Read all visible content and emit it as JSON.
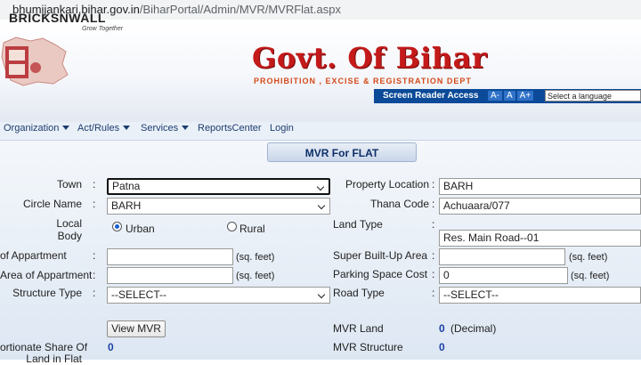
{
  "browser": {
    "url_host": "bhumijankari.bihar.gov.in",
    "url_path": "/BiharPortal/Admin/MVR/MVRFlat.aspx"
  },
  "header": {
    "brand_logo": "BRICKSNWALL",
    "brand_tagline": "Grow Together",
    "title": "Govt. Of Bihar",
    "subtitle": "PROHIBITION , EXCISE & REGISTRATION DEPT",
    "screen_reader_label": "Screen Reader Access",
    "font_buttons": [
      "A-",
      "A",
      "A+"
    ],
    "language_select": "Select a language"
  },
  "nav": {
    "items": [
      {
        "label": "Organization",
        "dropdown": true
      },
      {
        "label": "Act/Rules",
        "dropdown": true
      },
      {
        "label": "Services",
        "dropdown": true
      },
      {
        "label": "ReportsCenter",
        "dropdown": false
      },
      {
        "label": "Login",
        "dropdown": false
      }
    ]
  },
  "form": {
    "title": "MVR For FLAT",
    "town": {
      "label": "Town",
      "value": "Patna"
    },
    "circle_name": {
      "label": "Circle Name",
      "value": "BARH"
    },
    "local_body": {
      "label_line1": "Local",
      "label_line2": "Body",
      "option_urban": "Urban",
      "option_rural": "Rural",
      "selected": "Urban"
    },
    "area_of_appartment": {
      "label": "of Appartment",
      "value": "",
      "unit": "(sq. feet)"
    },
    "carpet_area": {
      "label": "Area of Appartment",
      "value": "",
      "unit": "(sq. feet)"
    },
    "structure_type": {
      "label": "Structure Type",
      "value": "--SELECT--"
    },
    "property_location": {
      "label": "Property Location",
      "value": "BARH"
    },
    "thana_code": {
      "label": "Thana Code",
      "value": "Achuaara/077"
    },
    "land_type": {
      "label": "Land Type",
      "value": "Res. Main Road--01"
    },
    "super_built_up": {
      "label": "Super Built-Up Area",
      "value": "",
      "unit": "(sq. feet)"
    },
    "parking_space_cost": {
      "label": "Parking Space Cost",
      "value": "0",
      "unit": "(sq. feet)"
    },
    "road_type": {
      "label": "Road Type",
      "value": "--SELECT--"
    },
    "view_button": "View MVR",
    "mvr_land": {
      "label": "MVR Land",
      "value": "0",
      "unit": "(Decimal)"
    },
    "mvr_structure": {
      "label": "MVR Structure",
      "value": "0"
    },
    "proportionate_share": {
      "label_line1": "ortionate Share Of",
      "label_line2": "Land in Flat",
      "value": "0"
    }
  },
  "colors": {
    "title_red": "#c41a1a",
    "nav_text": "#1d3c6e",
    "value_blue": "#1b3fa6",
    "screen_reader_bar": "#0b4a98"
  }
}
